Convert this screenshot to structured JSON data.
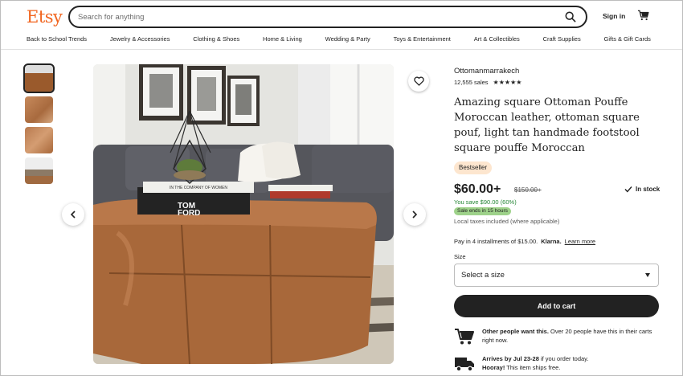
{
  "header": {
    "logo": "Etsy",
    "search_placeholder": "Search for anything",
    "sign_in": "Sign in",
    "search_icon": "search-icon",
    "cart_icon": "cart-icon"
  },
  "categories": [
    "Back to School Trends",
    "Jewelry & Accessories",
    "Clothing & Shoes",
    "Home & Living",
    "Wedding & Party",
    "Toys & Entertainment",
    "Art & Collectibles",
    "Craft Supplies",
    "Gifts & Gift Cards"
  ],
  "gallery": {
    "thumbnail_count": 4,
    "selected_index": 0,
    "photo_book_text": "TOM FORD",
    "photo_book_subtitle": "IN THE COMPANY OF WOMEN"
  },
  "product": {
    "shop_name": "Ottomanmarrakech",
    "sales": "12,555 sales",
    "stars": "★★★★★",
    "rating": 5,
    "title": "Amazing square Ottoman Pouffe Moroccan leather, ottoman square pouf, light tan handmade footstool square pouffe Moroccan",
    "badge": "Bestseller",
    "price": "$60.00+",
    "old_price": "$150.00+",
    "stock": "In stock",
    "savings": "You save $90.00 (60%)",
    "sale_ends": "Sale ends in 15 hours",
    "taxes": "Local taxes included (where applicable)",
    "installments_text": "Pay in 4 installments of $15.00.",
    "klarna": "Klarna.",
    "learn_more": "Learn more",
    "size_label": "Size",
    "size_select": "Select a size",
    "add_to_cart": "Add to cart",
    "demand_bold": "Other people want this.",
    "demand_text": "Over 20 people have this in their carts right now.",
    "arrival_bold": "Arrives by Jul 23-28",
    "arrival_text": "if you order today.",
    "ships_bold": "Hooray!",
    "ships_text": "This item ships free."
  },
  "colors": {
    "brand": "#f1641e",
    "save_green": "#258635",
    "sale_badge": "#9ed28a",
    "bestseller_bg": "#fde6cf"
  }
}
